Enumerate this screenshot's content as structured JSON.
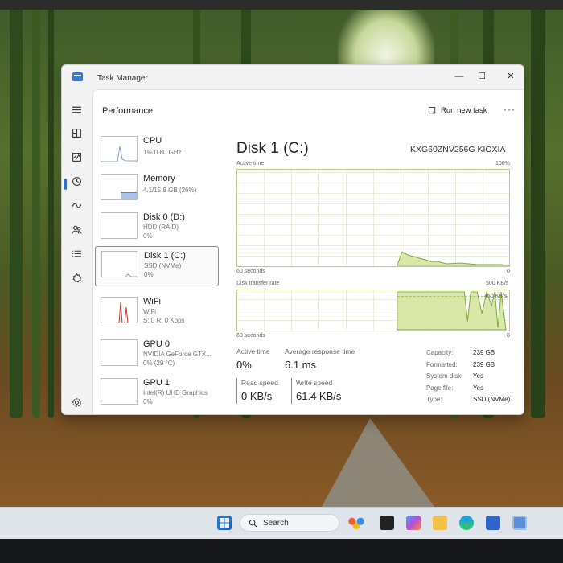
{
  "window": {
    "title": "Task Manager",
    "minimize": "—",
    "maximize": "☐",
    "close": "✕"
  },
  "header": {
    "page_title": "Performance",
    "run_task_label": "Run new task",
    "more_label": "···"
  },
  "nav": [
    "menu",
    "processes",
    "performance",
    "app-history",
    "startup",
    "users",
    "details",
    "services",
    "settings"
  ],
  "devices": [
    {
      "name": "CPU",
      "sub1": "1% 0.80 GHz",
      "sub2": ""
    },
    {
      "name": "Memory",
      "sub1": "4.1/15.8 GB (26%)",
      "sub2": ""
    },
    {
      "name": "Disk 0 (D:)",
      "sub1": "HDD (RAID)",
      "sub2": "0%"
    },
    {
      "name": "Disk 1 (C:)",
      "sub1": "SSD (NVMe)",
      "sub2": "0%"
    },
    {
      "name": "WiFi",
      "sub1": "WiFi",
      "sub2": "S: 0 R: 0 Kbps"
    },
    {
      "name": "GPU 0",
      "sub1": "NVIDIA GeForce GTX...",
      "sub2": "0% (29 °C)"
    },
    {
      "name": "GPU 1",
      "sub1": "Intel(R) UHD Graphics",
      "sub2": "0%"
    }
  ],
  "main": {
    "title": "Disk 1 (C:)",
    "model": "KXG60ZNV256G KIOXIA",
    "active_time_graph": {
      "label": "Active time",
      "max": "100%",
      "time": "60 seconds",
      "min": "0"
    },
    "transfer_graph": {
      "label": "Disk transfer rate",
      "max": "500 KB/s",
      "inner_max": "450 KB/s",
      "time": "60 seconds",
      "min": "0"
    },
    "stats": {
      "active_time_label": "Active time",
      "active_time_value": "0%",
      "response_label": "Average response time",
      "response_value": "6.1 ms",
      "read_label": "Read speed",
      "read_value": "0 KB/s",
      "write_label": "Write speed",
      "write_value": "61.4 KB/s"
    },
    "properties": [
      {
        "k": "Capacity:",
        "v": "239 GB"
      },
      {
        "k": "Formatted:",
        "v": "239 GB"
      },
      {
        "k": "System disk:",
        "v": "Yes"
      },
      {
        "k": "Page file:",
        "v": "Yes"
      },
      {
        "k": "Type:",
        "v": "SSD (NVMe)"
      }
    ]
  },
  "taskbar": {
    "search_placeholder": "Search"
  },
  "colors": {
    "accent": "#2f6fd0",
    "disk_graph_fill": "#d9e8a8",
    "disk_graph_line": "#7ea540",
    "wifi_spike": "#c0392b",
    "memory_fill": "#a9c3e8"
  }
}
